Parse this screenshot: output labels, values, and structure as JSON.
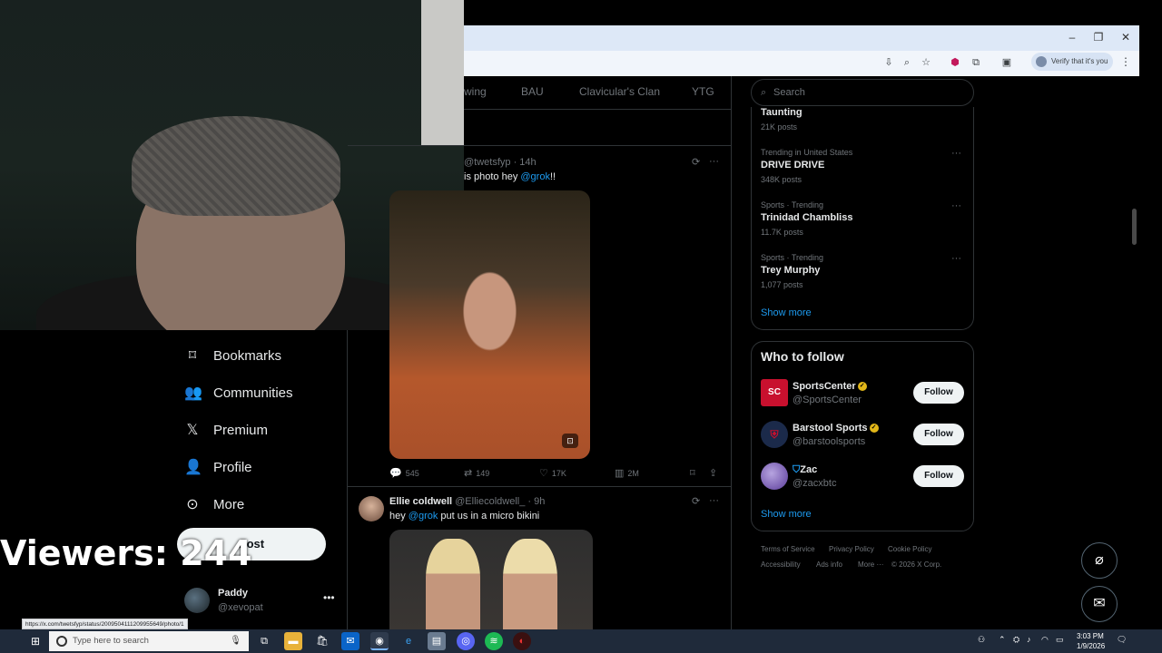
{
  "browser": {
    "verify_label": "Verify that it's you",
    "window_controls": [
      "–",
      "❐",
      "✕"
    ]
  },
  "stream": {
    "viewers_label": "Viewers: 244"
  },
  "nav": {
    "items": [
      {
        "label": "Bookmarks",
        "icon": "bookmark-icon"
      },
      {
        "label": "Communities",
        "icon": "communities-icon"
      },
      {
        "label": "Premium",
        "icon": "x-logo-icon"
      },
      {
        "label": "Profile",
        "icon": "profile-icon"
      },
      {
        "label": "More",
        "icon": "more-circle-icon"
      }
    ],
    "post_label": "Post",
    "account": {
      "name": "Paddy",
      "handle": "@xevopat"
    }
  },
  "feed": {
    "tabs": [
      "wing",
      "BAU",
      "Clavicular's Clan",
      "YTG"
    ],
    "tweet1": {
      "handle_time": "@twetsfyp · 14h",
      "text_pre": "is photo hey ",
      "mention": "@grok",
      "text_post": "!!",
      "stats": {
        "replies": "545",
        "reposts": "149",
        "likes": "17K",
        "views": "2M"
      }
    },
    "tweet2": {
      "name": "Ellie coldwell",
      "handle_time": "@Elliecoldwell_ · 9h",
      "text_pre": "hey ",
      "mention": "@grok",
      "text_post": " put us in a micro bikini"
    }
  },
  "sidebar": {
    "search_placeholder": "Search",
    "trends": [
      {
        "category": "",
        "name": "Taunting",
        "count": "21K posts"
      },
      {
        "category": "Trending in United States",
        "name": "DRIVE DRIVE",
        "count": "348K posts"
      },
      {
        "category": "Sports · Trending",
        "name": "Trinidad Chambliss",
        "count": "11.7K posts"
      },
      {
        "category": "Sports · Trending",
        "name": "Trey Murphy",
        "count": "1,077 posts"
      }
    ],
    "trends_show_more": "Show more",
    "who_to_follow": {
      "title": "Who to follow",
      "accounts": [
        {
          "name": "SportsCenter",
          "handle": "@SportsCenter",
          "follow": "Follow"
        },
        {
          "name": "Barstool Sports",
          "handle": "@barstoolsports",
          "follow": "Follow"
        },
        {
          "name": "Zac",
          "handle": "@zacxbtc",
          "follow": "Follow"
        }
      ],
      "show_more": "Show more"
    },
    "footer": [
      "Terms of Service",
      "Privacy Policy",
      "Cookie Policy",
      "Accessibility",
      "Ads info",
      "More ···",
      "© 2026 X Corp."
    ]
  },
  "status_url": "https://x.com/twetsfyp/status/2009504111209955649/photo/1",
  "taskbar": {
    "search_placeholder": "Type here to search",
    "time": "3:03 PM",
    "date": "1/9/2026"
  },
  "colors": {
    "accent": "#1d9bf0",
    "background": "#000000",
    "taskbar": "#1f2a3a"
  }
}
